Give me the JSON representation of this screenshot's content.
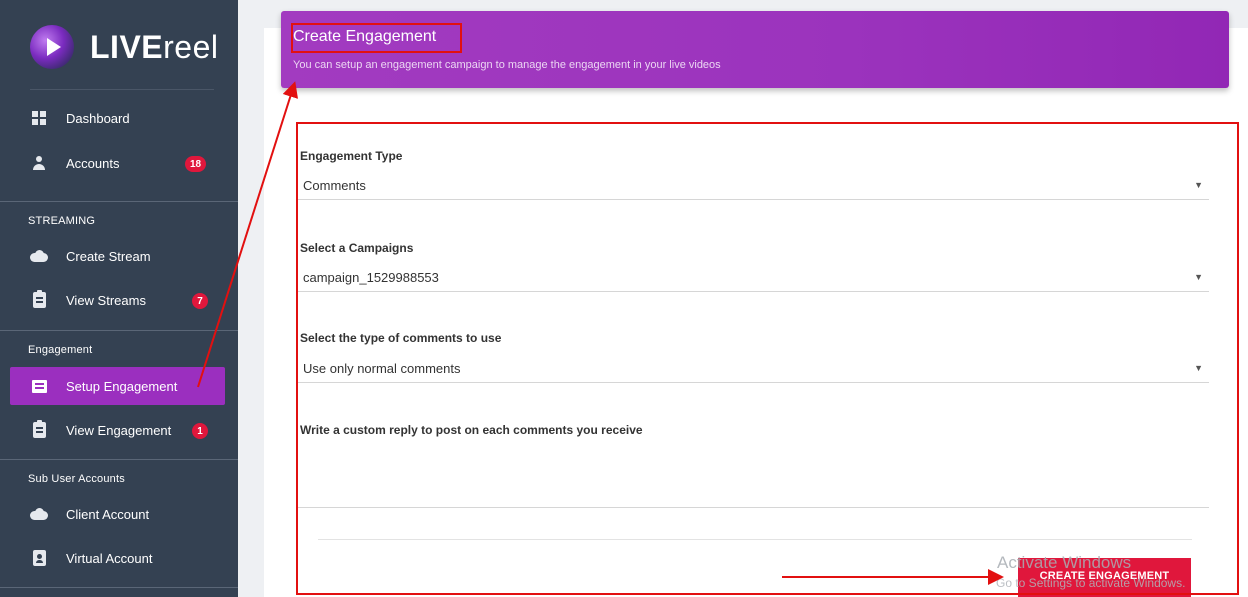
{
  "brand": {
    "name_bold": "LIVE",
    "name_light": "reel"
  },
  "sidebar": {
    "items": [
      {
        "id": "dashboard",
        "label": "Dashboard",
        "icon": "dashboard-icon"
      },
      {
        "id": "accounts",
        "label": "Accounts",
        "icon": "person-icon",
        "badge": "18"
      },
      {
        "id": "create-stream",
        "label": "Create Stream",
        "icon": "cloud-upload-icon"
      },
      {
        "id": "view-streams",
        "label": "View Streams",
        "icon": "clipboard-icon",
        "badge": "7"
      },
      {
        "id": "setup-engagement",
        "label": "Setup Engagement",
        "icon": "chat-icon"
      },
      {
        "id": "view-engagement",
        "label": "View Engagement",
        "icon": "clipboard-icon",
        "badge": "1"
      },
      {
        "id": "client-account",
        "label": "Client Account",
        "icon": "cloud-upload-icon"
      },
      {
        "id": "virtual-account",
        "label": "Virtual Account",
        "icon": "contact-icon"
      }
    ],
    "sections": [
      "STREAMING",
      "Engagement",
      "Sub User Accounts"
    ]
  },
  "header": {
    "title": "Create Engagement",
    "subtitle": "You can setup an engagement campaign to manage the engagement in your live videos"
  },
  "form": {
    "engagement_type": {
      "label": "Engagement Type",
      "value": "Comments"
    },
    "campaign": {
      "label": "Select a Campaigns",
      "value": "campaign_1529988553"
    },
    "comment_type": {
      "label": "Select the type of comments to use",
      "value": "Use only normal comments"
    },
    "custom_reply": {
      "label": "Write a custom reply to post on each comments you receive",
      "value": ""
    },
    "submit_label": "CREATE ENGAGEMENT"
  },
  "watermark": {
    "title": "Activate Windows",
    "subtitle": "Go to Settings to activate Windows."
  },
  "colors": {
    "sidebar_bg": "#344152",
    "accent": "#9b2fbf",
    "badge": "#e0173c",
    "annotation": "#e21010"
  }
}
